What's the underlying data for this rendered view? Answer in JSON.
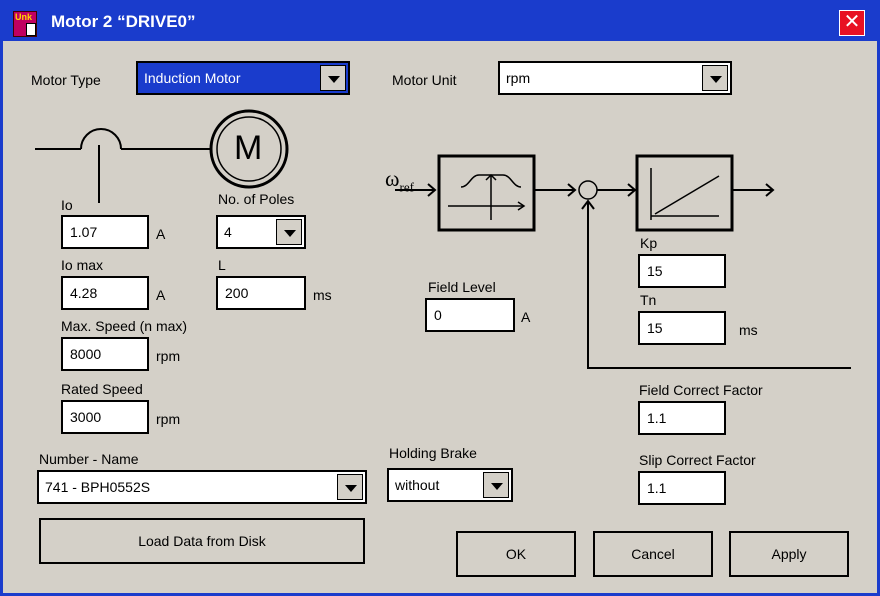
{
  "window": {
    "title": "Motor 2 “DRIVE0”",
    "icon_label": "Unk"
  },
  "motor_type": {
    "label": "Motor Type",
    "value": "Induction Motor"
  },
  "motor_unit": {
    "label": "Motor Unit",
    "value": "rpm"
  },
  "motor_symbol": "M",
  "io": {
    "label": "Io",
    "value": "1.07",
    "unit": "A"
  },
  "io_max": {
    "label": "Io max",
    "value": "4.28",
    "unit": "A"
  },
  "poles": {
    "label": "No. of Poles",
    "value": "4"
  },
  "inductance": {
    "label": "L",
    "value": "200",
    "unit": "ms"
  },
  "max_speed": {
    "label": "Max. Speed (n max)",
    "value": "8000",
    "unit": "rpm"
  },
  "rated_speed": {
    "label": "Rated Speed",
    "value": "3000",
    "unit": "rpm"
  },
  "number_name": {
    "label": "Number - Name",
    "value": "741 - BPH0552S"
  },
  "holding_brake": {
    "label": "Holding Brake",
    "value": "without"
  },
  "field_level": {
    "label": "Field Level",
    "value": "0",
    "unit": "A"
  },
  "omega_ref": {
    "symbol": "ω",
    "subscript": "ref"
  },
  "kp": {
    "label": "Kp",
    "value": "15"
  },
  "tn": {
    "label": "Tn",
    "value": "15",
    "unit": "ms"
  },
  "field_correct": {
    "label": "Field Correct Factor",
    "value": "1.1"
  },
  "slip_correct": {
    "label": "Slip Correct Factor",
    "value": "1.1"
  },
  "buttons": {
    "load": "Load Data from Disk",
    "ok": "OK",
    "cancel": "Cancel",
    "apply": "Apply"
  },
  "colors": {
    "title_bar": "#1a3ccc",
    "dialog_bg": "#d4d0c8",
    "close": "#e81123"
  }
}
